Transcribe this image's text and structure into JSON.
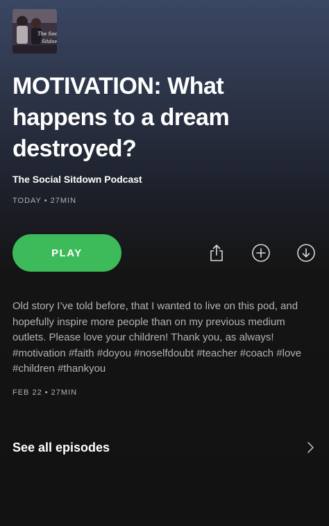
{
  "cover": {
    "art_text_line1": "The Social",
    "art_text_line2": "Sitdown",
    "icon": "podcast-cover-art"
  },
  "episode": {
    "title": "MOTIVATION: What happens to a dream destroyed?",
    "podcast_name": "The Social Sitdown Podcast",
    "meta_top": "TODAY • 27MIN",
    "description": "Old story I’ve told before, that I wanted to live on this pod, and hopefully inspire more people than on my previous medium outlets. Please love your children! Thank you, as always! #motivation #faith #doyou #noselfdoubt #teacher #coach #love #children #thankyou",
    "meta_bottom": "FEB 22 • 27MIN"
  },
  "actions": {
    "play_label": "PLAY",
    "share_icon": "share-icon",
    "add_icon": "add-circle-icon",
    "download_icon": "download-circle-icon"
  },
  "footer": {
    "see_all_label": "See all episodes",
    "chevron_icon": "chevron-right-icon"
  },
  "colors": {
    "accent": "#3dba5a",
    "background": "#121212",
    "header_gradient_top": "#3a4763",
    "secondary_text": "#b3b3b3"
  }
}
